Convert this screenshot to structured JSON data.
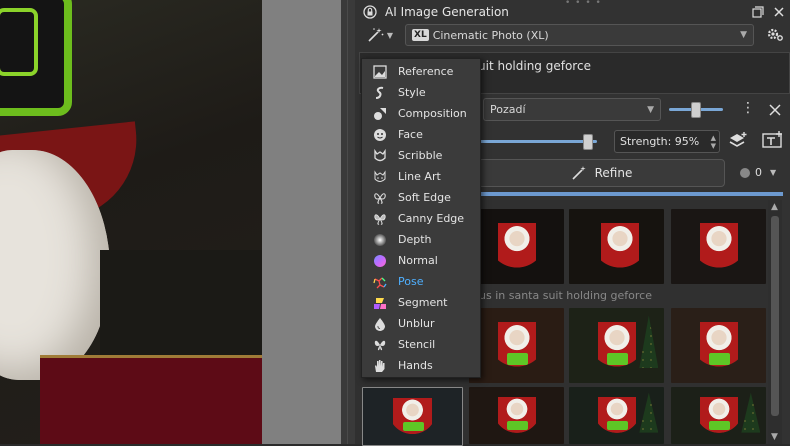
{
  "panel": {
    "title": "AI Image Generation",
    "style_name": "Cinematic Photo (XL)",
    "style_badge": "XL",
    "prompt_text": "uit holding geforce",
    "control_layer": "Pozadí",
    "strength_label": "Strength: 95%",
    "refine_label": "Refine",
    "queue_count": "0",
    "history_prompt": "us in santa suit holding geforce"
  },
  "menu": {
    "items": [
      {
        "label": "Reference",
        "icon": "reference-icon"
      },
      {
        "label": "Style",
        "icon": "style-icon"
      },
      {
        "label": "Composition",
        "icon": "composition-icon"
      },
      {
        "label": "Face",
        "icon": "face-icon"
      },
      {
        "label": "Scribble",
        "icon": "scribble-icon"
      },
      {
        "label": "Line Art",
        "icon": "line-art-icon"
      },
      {
        "label": "Soft Edge",
        "icon": "soft-edge-icon"
      },
      {
        "label": "Canny Edge",
        "icon": "canny-edge-icon"
      },
      {
        "label": "Depth",
        "icon": "depth-icon"
      },
      {
        "label": "Normal",
        "icon": "normal-icon"
      },
      {
        "label": "Pose",
        "icon": "pose-icon"
      },
      {
        "label": "Segment",
        "icon": "segment-icon"
      },
      {
        "label": "Unblur",
        "icon": "unblur-icon"
      },
      {
        "label": "Stencil",
        "icon": "stencil-icon"
      },
      {
        "label": "Hands",
        "icon": "hands-icon"
      }
    ],
    "selected_index": 10
  },
  "colors": {
    "accent": "#4fb0ff",
    "progress": "#6d9ad0",
    "panel_bg": "#323232"
  }
}
